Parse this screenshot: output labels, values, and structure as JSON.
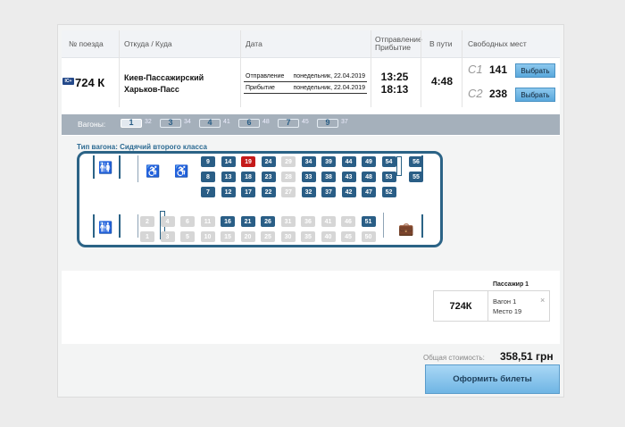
{
  "header": {
    "col_train": "№ поезда",
    "col_route": "Откуда / Куда",
    "col_date": "Дата",
    "col_dep": "Отправление",
    "col_arr": "Прибытие",
    "col_travel": "В пути",
    "col_free": "Свободных мест"
  },
  "train": {
    "badge": "IC+",
    "number": "724 К",
    "from": "Киев-Пассажирский",
    "to": "Харьков-Пасс",
    "dep_label": "Отправление",
    "dep_date": "понедельник, 22.04.2019",
    "arr_label": "Прибытие",
    "arr_date": "понедельник, 22.04.2019",
    "dep_time": "13:25",
    "arr_time": "18:13",
    "travel": "4:48",
    "classes": [
      {
        "name": "С1",
        "count": "141",
        "button": "Выбрать"
      },
      {
        "name": "С2",
        "count": "238",
        "button": "Выбрать"
      }
    ]
  },
  "wagons": {
    "label": "Вагоны:",
    "items": [
      {
        "num": "1",
        "free": "32",
        "active": true
      },
      {
        "num": "3",
        "free": "34"
      },
      {
        "num": "4",
        "free": "41"
      },
      {
        "num": "6",
        "free": "48"
      },
      {
        "num": "7",
        "free": "45"
      },
      {
        "num": "9",
        "free": "37"
      }
    ]
  },
  "wagon_type": "Тип вагона: Сидячий второго класса",
  "seats": {
    "row1": [
      {
        "n": "9",
        "s": "free"
      },
      {
        "n": "14",
        "s": "free"
      },
      {
        "n": "19",
        "s": "sel"
      },
      {
        "n": "24",
        "s": "free"
      },
      {
        "n": "29",
        "s": "busy"
      },
      {
        "n": "34",
        "s": "free"
      },
      {
        "n": "39",
        "s": "free"
      },
      {
        "n": "44",
        "s": "free"
      },
      {
        "n": "49",
        "s": "free"
      },
      {
        "n": "54",
        "s": "free"
      }
    ],
    "row2": [
      {
        "n": "8",
        "s": "free"
      },
      {
        "n": "13",
        "s": "free"
      },
      {
        "n": "18",
        "s": "free"
      },
      {
        "n": "23",
        "s": "free"
      },
      {
        "n": "28",
        "s": "busy"
      },
      {
        "n": "33",
        "s": "free"
      },
      {
        "n": "38",
        "s": "free"
      },
      {
        "n": "43",
        "s": "free"
      },
      {
        "n": "48",
        "s": "free"
      },
      {
        "n": "53",
        "s": "free"
      }
    ],
    "row3": [
      {
        "n": "7",
        "s": "free"
      },
      {
        "n": "12",
        "s": "free"
      },
      {
        "n": "17",
        "s": "free"
      },
      {
        "n": "22",
        "s": "free"
      },
      {
        "n": "27",
        "s": "busy"
      },
      {
        "n": "32",
        "s": "free"
      },
      {
        "n": "37",
        "s": "free"
      },
      {
        "n": "42",
        "s": "free"
      },
      {
        "n": "47",
        "s": "free"
      },
      {
        "n": "52",
        "s": "free"
      }
    ],
    "row4": [
      {
        "n": "2",
        "s": "busy"
      },
      {
        "n": "4",
        "s": "busy"
      },
      {
        "n": "6",
        "s": "busy"
      },
      {
        "n": "11",
        "s": "busy"
      },
      {
        "n": "16",
        "s": "free"
      },
      {
        "n": "21",
        "s": "free"
      },
      {
        "n": "26",
        "s": "free"
      },
      {
        "n": "31",
        "s": "busy"
      },
      {
        "n": "36",
        "s": "busy"
      },
      {
        "n": "41",
        "s": "busy"
      },
      {
        "n": "46",
        "s": "busy"
      },
      {
        "n": "51",
        "s": "free"
      }
    ],
    "row5": [
      {
        "n": "1",
        "s": "busy"
      },
      {
        "n": "3",
        "s": "busy"
      },
      {
        "n": "5",
        "s": "busy"
      },
      {
        "n": "10",
        "s": "busy"
      },
      {
        "n": "15",
        "s": "busy"
      },
      {
        "n": "20",
        "s": "busy"
      },
      {
        "n": "25",
        "s": "busy"
      },
      {
        "n": "30",
        "s": "busy"
      },
      {
        "n": "35",
        "s": "busy"
      },
      {
        "n": "40",
        "s": "busy"
      },
      {
        "n": "45",
        "s": "busy"
      },
      {
        "n": "50",
        "s": "busy"
      }
    ],
    "right": [
      {
        "n": "56",
        "s": "free"
      },
      {
        "n": "55",
        "s": "free"
      }
    ]
  },
  "passenger": {
    "title": "Пассажир 1",
    "train": "724К",
    "wagon": "Вагон 1",
    "seat": "Место 19",
    "close": "×"
  },
  "total": {
    "label": "Общая стоимость:",
    "value": "358,51 грн"
  },
  "order_button": "Оформить билеты",
  "icons": {
    "toilet": "toilet-icon",
    "wheelchair": "wheelchair-icon",
    "luggage": "luggage-icon"
  }
}
